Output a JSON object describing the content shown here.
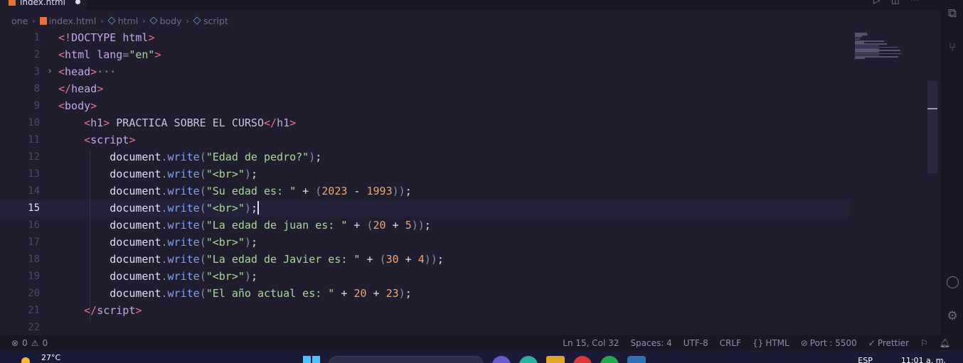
{
  "tab": {
    "filename": "index.html",
    "icon": "html5-file-icon",
    "modified": true
  },
  "breadcrumb": [
    "one",
    "index.html",
    "html",
    "body",
    "script"
  ],
  "editor": {
    "current_line": 15,
    "lines": [
      {
        "n": "1",
        "tokens": [
          [
            "tag",
            "<!"
          ],
          [
            "name",
            "DOCTYPE"
          ],
          [
            "text",
            " "
          ],
          [
            "name",
            "html"
          ],
          [
            "tag",
            ">"
          ]
        ]
      },
      {
        "n": "2",
        "tokens": [
          [
            "tag",
            "<"
          ],
          [
            "name",
            "html"
          ],
          [
            "text",
            " "
          ],
          [
            "attr",
            "lang"
          ],
          [
            "punc",
            "="
          ],
          [
            "str",
            "\"en\""
          ],
          [
            "tag",
            ">"
          ]
        ]
      },
      {
        "n": "3",
        "fold": true,
        "tokens": [
          [
            "tag",
            "<"
          ],
          [
            "name",
            "head"
          ],
          [
            "tag",
            ">"
          ],
          [
            "punc",
            "···"
          ]
        ]
      },
      {
        "n": "8",
        "tokens": [
          [
            "tag",
            "</"
          ],
          [
            "name",
            "head"
          ],
          [
            "tag",
            ">"
          ]
        ]
      },
      {
        "n": "9",
        "tokens": [
          [
            "tag",
            "<"
          ],
          [
            "name",
            "body"
          ],
          [
            "tag",
            ">"
          ]
        ]
      },
      {
        "n": "10",
        "tokens": [
          [
            "text",
            "    "
          ],
          [
            "tag",
            "<"
          ],
          [
            "name",
            "h1"
          ],
          [
            "tag",
            ">"
          ],
          [
            "text",
            " PRACTICA SOBRE EL CURSO"
          ],
          [
            "tag",
            "</"
          ],
          [
            "name",
            "h1"
          ],
          [
            "tag",
            ">"
          ]
        ]
      },
      {
        "n": "11",
        "tokens": [
          [
            "text",
            "    "
          ],
          [
            "tag",
            "<"
          ],
          [
            "name",
            "script"
          ],
          [
            "tag",
            ">"
          ]
        ]
      },
      {
        "n": "12",
        "tokens": [
          [
            "text",
            "        "
          ],
          [
            "obj",
            "document"
          ],
          [
            "punc",
            "."
          ],
          [
            "fn",
            "write"
          ],
          [
            "punc",
            "("
          ],
          [
            "str",
            "\"Edad de pedro?\""
          ],
          [
            "punc",
            ")"
          ],
          [
            "op",
            ";"
          ]
        ]
      },
      {
        "n": "13",
        "tokens": [
          [
            "text",
            "        "
          ],
          [
            "obj",
            "document"
          ],
          [
            "punc",
            "."
          ],
          [
            "fn",
            "write"
          ],
          [
            "punc",
            "("
          ],
          [
            "str",
            "\"<br>\""
          ],
          [
            "punc",
            ")"
          ],
          [
            "op",
            ";"
          ]
        ]
      },
      {
        "n": "14",
        "tokens": [
          [
            "text",
            "        "
          ],
          [
            "obj",
            "document"
          ],
          [
            "punc",
            "."
          ],
          [
            "fn",
            "write"
          ],
          [
            "punc",
            "("
          ],
          [
            "str",
            "\"Su edad es: \""
          ],
          [
            "op",
            " + "
          ],
          [
            "punc",
            "("
          ],
          [
            "num",
            "2023"
          ],
          [
            "op",
            " - "
          ],
          [
            "num",
            "1993"
          ],
          [
            "punc",
            "))"
          ],
          [
            "op",
            ";"
          ]
        ]
      },
      {
        "n": "15",
        "tokens": [
          [
            "text",
            "        "
          ],
          [
            "obj",
            "document"
          ],
          [
            "punc",
            "."
          ],
          [
            "fn",
            "write"
          ],
          [
            "punc",
            "("
          ],
          [
            "str",
            "\"<br>\""
          ],
          [
            "punc",
            ")"
          ],
          [
            "op",
            ";"
          ]
        ]
      },
      {
        "n": "16",
        "tokens": [
          [
            "text",
            "        "
          ],
          [
            "obj",
            "document"
          ],
          [
            "punc",
            "."
          ],
          [
            "fn",
            "write"
          ],
          [
            "punc",
            "("
          ],
          [
            "str",
            "\"La edad de juan es: \""
          ],
          [
            "op",
            " + "
          ],
          [
            "punc",
            "("
          ],
          [
            "num",
            "20"
          ],
          [
            "op",
            " + "
          ],
          [
            "num",
            "5"
          ],
          [
            "punc",
            "))"
          ],
          [
            "op",
            ";"
          ]
        ]
      },
      {
        "n": "17",
        "tokens": [
          [
            "text",
            "        "
          ],
          [
            "obj",
            "document"
          ],
          [
            "punc",
            "."
          ],
          [
            "fn",
            "write"
          ],
          [
            "punc",
            "("
          ],
          [
            "str",
            "\"<br>\""
          ],
          [
            "punc",
            ")"
          ],
          [
            "op",
            ";"
          ]
        ]
      },
      {
        "n": "18",
        "tokens": [
          [
            "text",
            "        "
          ],
          [
            "obj",
            "document"
          ],
          [
            "punc",
            "."
          ],
          [
            "fn",
            "write"
          ],
          [
            "punc",
            "("
          ],
          [
            "str",
            "\"La edad de Javier es: \""
          ],
          [
            "op",
            " + "
          ],
          [
            "punc",
            "("
          ],
          [
            "num",
            "30"
          ],
          [
            "op",
            " + "
          ],
          [
            "num",
            "4"
          ],
          [
            "punc",
            "))"
          ],
          [
            "op",
            ";"
          ]
        ]
      },
      {
        "n": "19",
        "tokens": [
          [
            "text",
            "        "
          ],
          [
            "obj",
            "document"
          ],
          [
            "punc",
            "."
          ],
          [
            "fn",
            "write"
          ],
          [
            "punc",
            "("
          ],
          [
            "str",
            "\"<br>\""
          ],
          [
            "punc",
            ")"
          ],
          [
            "op",
            ";"
          ]
        ]
      },
      {
        "n": "20",
        "tokens": [
          [
            "text",
            "        "
          ],
          [
            "obj",
            "document"
          ],
          [
            "punc",
            "."
          ],
          [
            "fn",
            "write"
          ],
          [
            "punc",
            "("
          ],
          [
            "str",
            "\"El año actual es: \""
          ],
          [
            "op",
            " + "
          ],
          [
            "num",
            "20"
          ],
          [
            "op",
            " + "
          ],
          [
            "num",
            "23"
          ],
          [
            "punc",
            ")"
          ],
          [
            "op",
            ";"
          ]
        ]
      },
      {
        "n": "21",
        "tokens": [
          [
            "text",
            "    "
          ],
          [
            "tag",
            "</"
          ],
          [
            "name",
            "script"
          ],
          [
            "tag",
            ">"
          ]
        ]
      },
      {
        "n": "22",
        "tokens": []
      }
    ]
  },
  "statusbar": {
    "errors": "0",
    "warnings": "0",
    "position": "Ln 15, Col 32",
    "spaces": "Spaces: 4",
    "encoding": "UTF-8",
    "eol": "CRLF",
    "language": "HTML",
    "port": "Port : 5500",
    "prettier": "Prettier"
  },
  "taskbar": {
    "temperature": "27°C",
    "language": "ESP",
    "time": "11:01 a. m."
  },
  "colors": {
    "editor_bg": "#1f1d2e",
    "tag": "#eb6f92",
    "name": "#c4a7e7",
    "string": "#a6da95",
    "function": "#7aa2f7",
    "number": "#f6a26b"
  }
}
